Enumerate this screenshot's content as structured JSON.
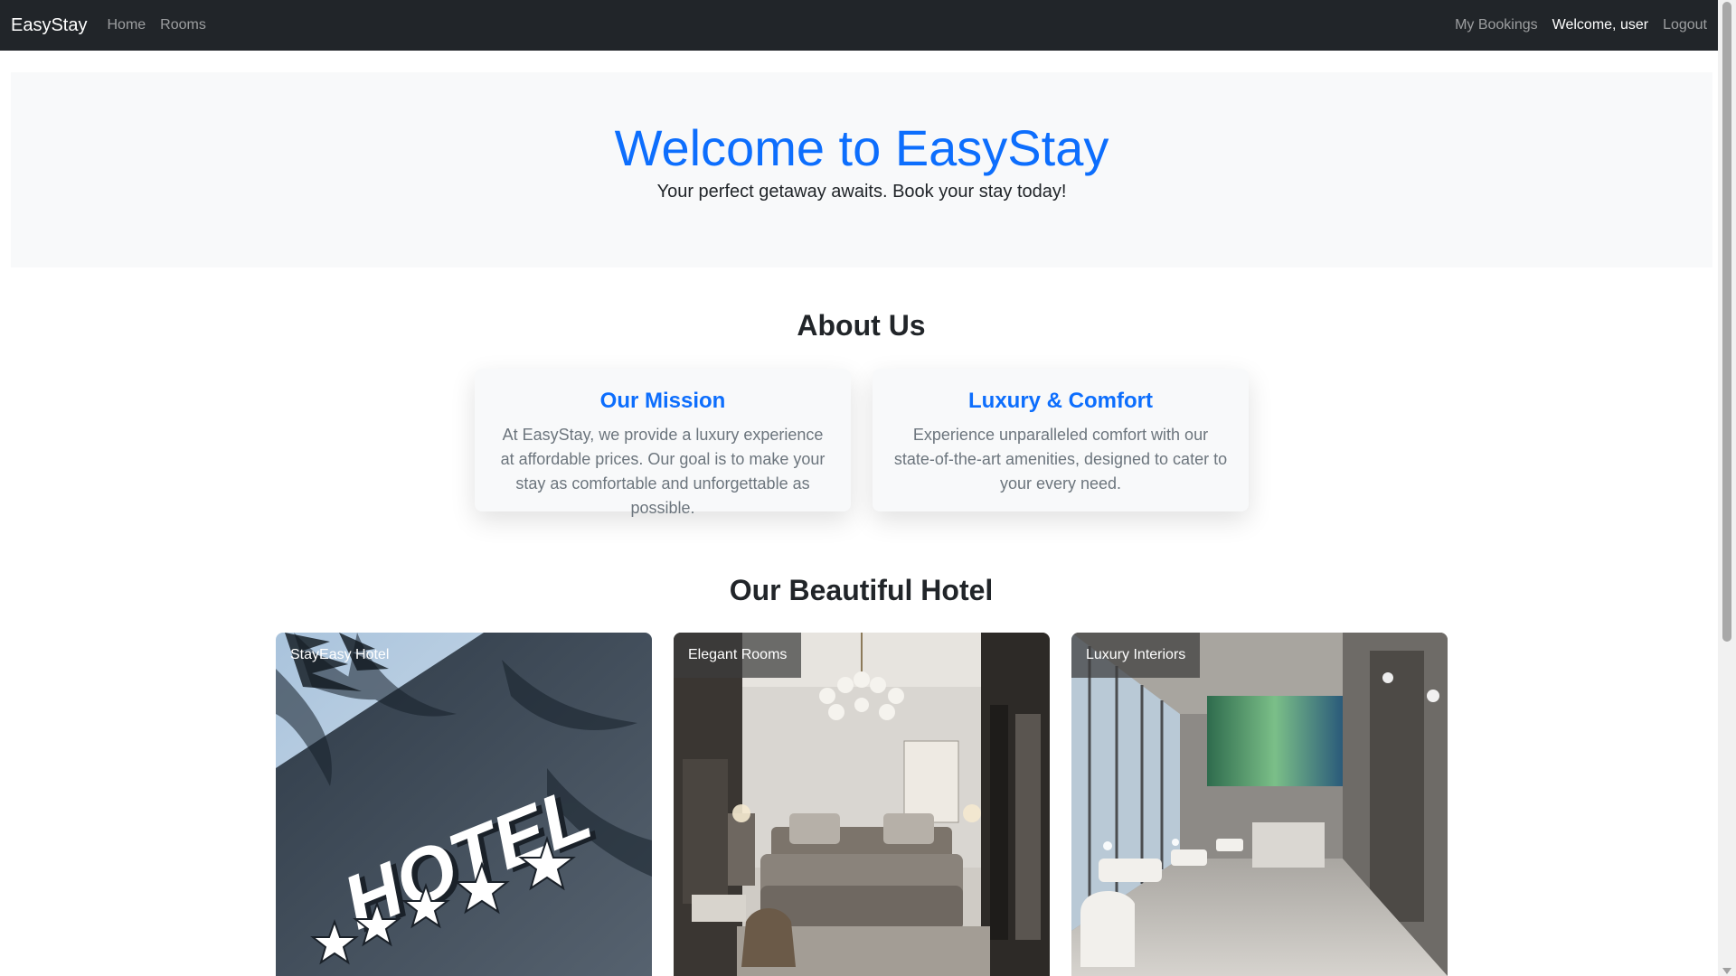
{
  "nav": {
    "brand": "EasyStay",
    "links": [
      "Home",
      "Rooms"
    ],
    "my_bookings": "My Bookings",
    "welcome": "Welcome, user",
    "logout": "Logout"
  },
  "hero": {
    "title": "Welcome to EasyStay",
    "subtitle": "Your perfect getaway awaits. Book your stay today!"
  },
  "about": {
    "title": "About Us",
    "cards": [
      {
        "title": "Our Mission",
        "text": "At EasyStay, we provide a luxury experience at affordable prices. Our goal is to make your stay as comfortable and unforgettable as possible."
      },
      {
        "title": "Luxury & Comfort",
        "text": "Experience unparalleled comfort with our state-of-the-art amenities, designed to cater to your every need."
      }
    ]
  },
  "gallery": {
    "title": "Our Beautiful Hotel",
    "photos": [
      {
        "label": "StayEasy Hotel",
        "sign_text": "HOTEL"
      },
      {
        "label": "Elegant Rooms"
      },
      {
        "label": "Luxury Interiors"
      }
    ]
  },
  "colors": {
    "navbar": "#212529",
    "primary": "#0d6efd",
    "hero_bg": "#f8f9fa",
    "muted": "#6c757d"
  }
}
